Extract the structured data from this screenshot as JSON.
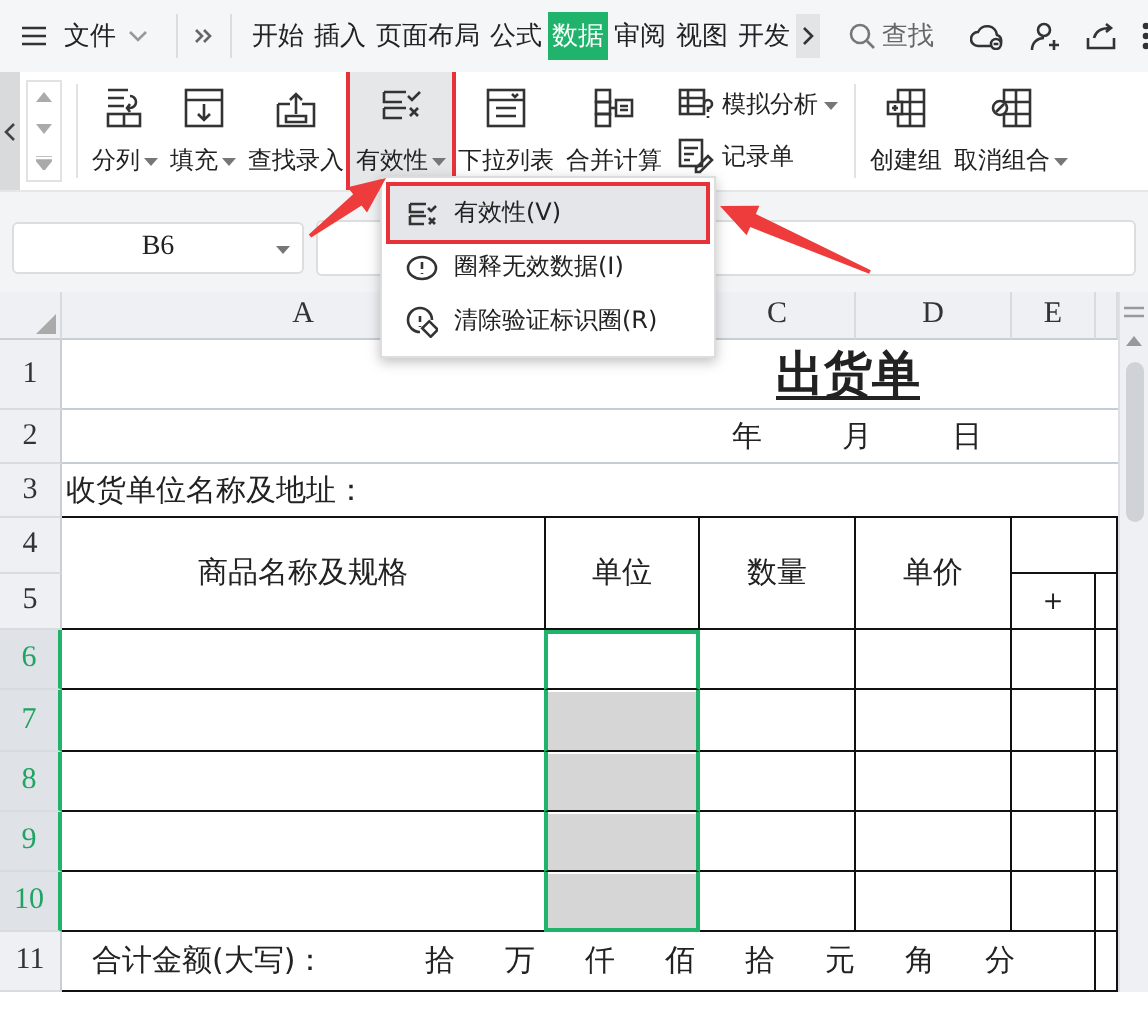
{
  "menubar": {
    "file_menu": {
      "label": "文件"
    },
    "tabs": [
      {
        "label": "开始",
        "selected": false
      },
      {
        "label": "插入",
        "selected": false
      },
      {
        "label": "页面布局",
        "selected": false
      },
      {
        "label": "公式",
        "selected": false
      },
      {
        "label": "数据",
        "selected": true
      },
      {
        "label": "审阅",
        "selected": false
      },
      {
        "label": "视图",
        "selected": false
      },
      {
        "label": "开发",
        "selected": false
      }
    ],
    "search": {
      "placeholder": "查找"
    }
  },
  "ribbon": {
    "buttons": [
      {
        "kind": "large",
        "label": "分列",
        "dropdown": true,
        "pressed": false,
        "annotated": false
      },
      {
        "kind": "large",
        "label": "填充",
        "dropdown": true,
        "pressed": false,
        "annotated": false
      },
      {
        "kind": "large",
        "label": "查找录入",
        "dropdown": false,
        "pressed": false,
        "annotated": false
      },
      {
        "kind": "large",
        "label": "有效性",
        "dropdown": true,
        "pressed": true,
        "annotated": true
      },
      {
        "kind": "large",
        "label": "下拉列表",
        "dropdown": false,
        "pressed": false,
        "annotated": false
      },
      {
        "kind": "large",
        "label": "合并计算",
        "dropdown": false,
        "pressed": false,
        "annotated": false
      },
      {
        "kind": "small",
        "label": "模拟分析",
        "dropdown": true,
        "pressed": false,
        "annotated": false
      },
      {
        "kind": "small",
        "label": "记录单",
        "dropdown": false,
        "pressed": false,
        "annotated": false
      },
      {
        "kind": "large",
        "label": "创建组",
        "dropdown": false,
        "pressed": false,
        "annotated": false
      },
      {
        "kind": "large",
        "label": "取消组合",
        "dropdown": true,
        "pressed": false,
        "annotated": false
      }
    ]
  },
  "formula_bar": {
    "name_box": "B6"
  },
  "validity_menu": {
    "items": [
      {
        "label": "有效性(V)",
        "selected": true,
        "annotated": true
      },
      {
        "label": "圈释无效数据(I)",
        "selected": false,
        "annotated": false
      },
      {
        "label": "清除验证标识圈(R)",
        "selected": false,
        "annotated": false
      }
    ]
  },
  "sheet": {
    "column_headers": [
      "A",
      "C",
      "D",
      "E"
    ],
    "row_headers": [
      {
        "label": "1",
        "selected": false
      },
      {
        "label": "2",
        "selected": false
      },
      {
        "label": "3",
        "selected": false
      },
      {
        "label": "4",
        "selected": false
      },
      {
        "label": "5",
        "selected": false
      },
      {
        "label": "6",
        "selected": true
      },
      {
        "label": "7",
        "selected": true
      },
      {
        "label": "8",
        "selected": true
      },
      {
        "label": "9",
        "selected": true
      },
      {
        "label": "10",
        "selected": true
      },
      {
        "label": "11",
        "selected": false
      }
    ],
    "title": "出货单",
    "date_labels": [
      "年",
      "月",
      "日"
    ],
    "address_label": "收货单位名称及地址：",
    "table_headers": [
      "商品名称及规格",
      "单位",
      "数量",
      "单价"
    ],
    "add_mark": "＋",
    "total_label": "合计金额(大写)：",
    "amount_units": [
      "拾",
      "万",
      "仟",
      "佰",
      "拾",
      "元",
      "角",
      "分"
    ]
  }
}
